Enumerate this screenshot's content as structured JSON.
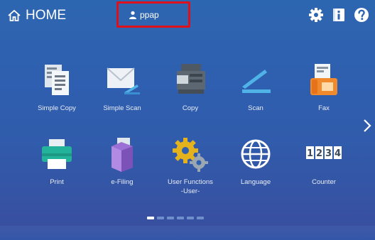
{
  "header": {
    "home_label": "HOME",
    "user_name": "ppap"
  },
  "apps_row1": [
    {
      "label": "Simple Copy"
    },
    {
      "label": "Simple Scan"
    },
    {
      "label": "Copy"
    },
    {
      "label": "Scan"
    },
    {
      "label": "Fax"
    }
  ],
  "apps_row2": [
    {
      "label": "Print"
    },
    {
      "label": "e-Filing"
    },
    {
      "label": "User Functions\n-User-"
    },
    {
      "label": "Language"
    },
    {
      "label": "Counter"
    }
  ],
  "counter_digits": "1234",
  "pager": {
    "pages": 6,
    "active": 1
  },
  "colors": {
    "highlight_border": "#e0101a",
    "background_top": "#2d66b0",
    "background_bottom": "#3a4d9e"
  }
}
